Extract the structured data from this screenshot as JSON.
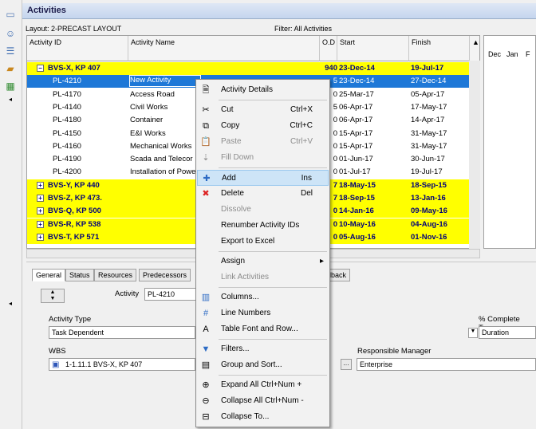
{
  "window": {
    "title": "Activities"
  },
  "toolbar": {
    "layout": "Layout: 2-PRECAST LAYOUT",
    "filter": "Filter: All Activities"
  },
  "columns": {
    "id": "Activity ID",
    "name": "Activity Name",
    "od": "O.D",
    "start": "Start",
    "finish": "Finish"
  },
  "gantt": {
    "months": [
      "Dec",
      "Jan",
      "F"
    ]
  },
  "rows": [
    {
      "type": "group",
      "id": "BVS-X, KP 407",
      "name": "",
      "od": "940",
      "start": "23-Dec-14",
      "finish": "19-Jul-17"
    },
    {
      "type": "task",
      "id": "PL-4210",
      "name": "New Activity",
      "od": "5",
      "start": "23-Dec-14",
      "finish": "27-Dec-14",
      "selected": true
    },
    {
      "type": "task",
      "id": "PL-4170",
      "name": "Access Road",
      "od": "0",
      "start": "25-Mar-17",
      "finish": "05-Apr-17"
    },
    {
      "type": "task",
      "id": "PL-4140",
      "name": "Civil Works",
      "od": "5",
      "start": "06-Apr-17",
      "finish": "17-May-17"
    },
    {
      "type": "task",
      "id": "PL-4180",
      "name": "Container",
      "od": "0",
      "start": "06-Apr-17",
      "finish": "14-Apr-17"
    },
    {
      "type": "task",
      "id": "PL-4150",
      "name": "E&I Works",
      "od": "0",
      "start": "15-Apr-17",
      "finish": "31-May-17"
    },
    {
      "type": "task",
      "id": "PL-4160",
      "name": "Mechanical Works",
      "od": "0",
      "start": "15-Apr-17",
      "finish": "31-May-17"
    },
    {
      "type": "task",
      "id": "PL-4190",
      "name": "Scada and Telecor",
      "od": "0",
      "start": "01-Jun-17",
      "finish": "30-Jun-17"
    },
    {
      "type": "task",
      "id": "PL-4200",
      "name": "Installation of Powe",
      "od": "0",
      "start": "01-Jul-17",
      "finish": "19-Jul-17"
    },
    {
      "type": "group",
      "id": "BVS-Y, KP 440",
      "name": "",
      "od": "7",
      "start": "18-May-15",
      "finish": "18-Sep-15"
    },
    {
      "type": "group",
      "id": "BVS-Z, KP 473.",
      "name": "",
      "od": "7",
      "start": "18-Sep-15",
      "finish": "13-Jan-16"
    },
    {
      "type": "group",
      "id": "BVS-Q, KP 500",
      "name": "",
      "od": "0",
      "start": "14-Jan-16",
      "finish": "09-May-16"
    },
    {
      "type": "group",
      "id": "BVS-R, KP 538",
      "name": "",
      "od": "0",
      "start": "10-May-16",
      "finish": "04-Aug-16"
    },
    {
      "type": "group",
      "id": "BVS-T, KP 571",
      "name": "",
      "od": "0",
      "start": "05-Aug-16",
      "finish": "01-Nov-16"
    }
  ],
  "detail": {
    "tabs": [
      "General",
      "Status",
      "Resources",
      "Predecessors",
      "dback"
    ],
    "activity_label": "Activity",
    "activity_value": "PL-4210",
    "activity_type_label": "Activity Type",
    "activity_type_value": "Task Dependent",
    "pct_type_label": "% Complete Type",
    "pct_type_value": "Duration",
    "wbs_label": "WBS",
    "wbs_value": "1-1.11.1  BVS-X, KP 407",
    "manager_label": "Responsible Manager",
    "manager_value": "Enterprise"
  },
  "context_menu": [
    {
      "label": "Activity Details",
      "shortcut": "",
      "icon": "activity-details-icon",
      "glyph": "🗎",
      "disabled": false
    },
    {
      "sep": true
    },
    {
      "label": "Cut",
      "shortcut": "Ctrl+X",
      "icon": "cut-icon",
      "glyph": "✂",
      "disabled": false
    },
    {
      "label": "Copy",
      "shortcut": "Ctrl+C",
      "icon": "copy-icon",
      "glyph": "⧉",
      "disabled": false
    },
    {
      "label": "Paste",
      "shortcut": "Ctrl+V",
      "icon": "paste-icon",
      "glyph": "📋",
      "disabled": true
    },
    {
      "label": "Fill Down",
      "shortcut": "",
      "icon": "fill-down-icon",
      "glyph": "⇣",
      "disabled": true
    },
    {
      "sep": true
    },
    {
      "label": "Add",
      "shortcut": "Ins",
      "icon": "add-icon",
      "glyph": "✚",
      "disabled": false,
      "highlight": true
    },
    {
      "label": "Delete",
      "shortcut": "Del",
      "icon": "delete-icon",
      "glyph": "✖",
      "disabled": false
    },
    {
      "label": "Dissolve",
      "shortcut": "",
      "icon": "",
      "glyph": "",
      "disabled": true
    },
    {
      "label": "Renumber Activity IDs",
      "shortcut": "",
      "icon": "",
      "glyph": "",
      "disabled": false
    },
    {
      "label": "Export to Excel",
      "shortcut": "",
      "icon": "",
      "glyph": "",
      "disabled": false
    },
    {
      "sep": true
    },
    {
      "label": "Assign",
      "shortcut": "▸",
      "icon": "",
      "glyph": "",
      "disabled": false
    },
    {
      "label": "Link Activities",
      "shortcut": "",
      "icon": "",
      "glyph": "",
      "disabled": true
    },
    {
      "sep": true
    },
    {
      "label": "Columns...",
      "shortcut": "",
      "icon": "columns-icon",
      "glyph": "▥",
      "disabled": false
    },
    {
      "label": "Line Numbers",
      "shortcut": "",
      "icon": "line-numbers-icon",
      "glyph": "#",
      "disabled": false
    },
    {
      "label": "Table Font and Row...",
      "shortcut": "",
      "icon": "table-font-icon",
      "glyph": "A",
      "disabled": false
    },
    {
      "sep": true
    },
    {
      "label": "Filters...",
      "shortcut": "",
      "icon": "filter-icon",
      "glyph": "▼",
      "disabled": false
    },
    {
      "label": "Group and Sort...",
      "shortcut": "",
      "icon": "group-sort-icon",
      "glyph": "▤",
      "disabled": false
    },
    {
      "sep": true
    },
    {
      "label": "Expand All  Ctrl+Num +",
      "shortcut": "",
      "icon": "expand-all-icon",
      "glyph": "⊕",
      "disabled": false
    },
    {
      "label": "Collapse All  Ctrl+Num -",
      "shortcut": "",
      "icon": "collapse-all-icon",
      "glyph": "⊖",
      "disabled": false
    },
    {
      "label": "Collapse To...",
      "shortcut": "",
      "icon": "collapse-to-icon",
      "glyph": "⊟",
      "disabled": false
    }
  ]
}
